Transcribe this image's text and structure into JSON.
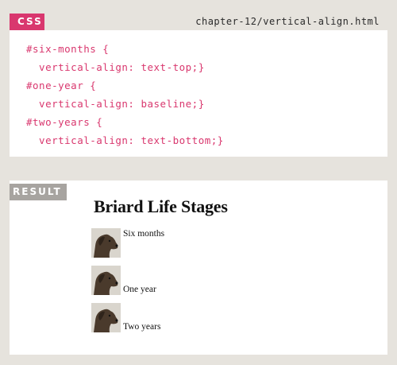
{
  "css_panel": {
    "tag": "CSS",
    "file_name": "chapter-12/vertical-align.html",
    "code_lines": [
      "#six-months {",
      "  vertical-align: text-top;}",
      "#one-year {",
      "  vertical-align: baseline;}",
      "#two-years {",
      "  vertical-align: text-bottom;}"
    ]
  },
  "result_panel": {
    "tag": "RESULT",
    "title": "Briard Life Stages",
    "stages": [
      {
        "label": "Six months",
        "icon": "dog-photo-icon"
      },
      {
        "label": "One year",
        "icon": "dog-photo-icon"
      },
      {
        "label": "Two years",
        "icon": "dog-photo-icon"
      }
    ]
  },
  "colors": {
    "background": "#e6e3dd",
    "accent": "#d9376e",
    "result_tag": "#a7a4a0"
  }
}
